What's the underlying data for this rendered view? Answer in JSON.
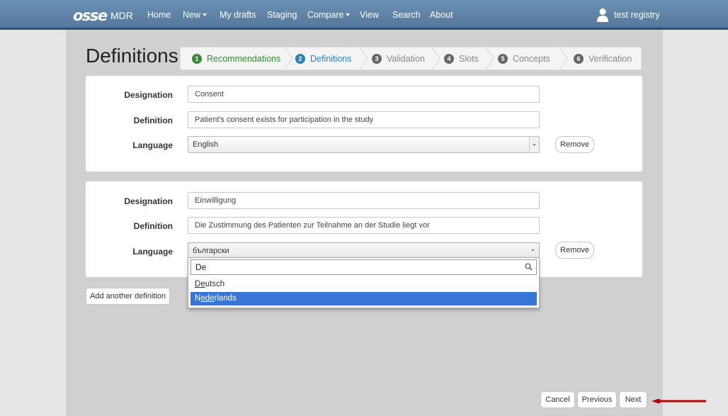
{
  "navbar": {
    "brand": "osse",
    "brand_suffix": "MDR",
    "items": [
      {
        "label": "Home"
      },
      {
        "label": "New",
        "dropdown": true
      },
      {
        "label": "My drafts"
      },
      {
        "label": "Staging"
      },
      {
        "label": "Compare",
        "dropdown": true
      },
      {
        "label": "View"
      },
      {
        "label": "Search"
      },
      {
        "label": "About"
      }
    ],
    "user": "test registry"
  },
  "page": {
    "title": "Definitions"
  },
  "wizard": {
    "steps": [
      {
        "num": "1",
        "label": "Recommendations",
        "state": "done"
      },
      {
        "num": "2",
        "label": "Definitions",
        "state": "active"
      },
      {
        "num": "3",
        "label": "Validation",
        "state": "todo"
      },
      {
        "num": "4",
        "label": "Slots",
        "state": "todo"
      },
      {
        "num": "5",
        "label": "Concepts",
        "state": "todo"
      },
      {
        "num": "6",
        "label": "Verification",
        "state": "todo"
      }
    ]
  },
  "labels": {
    "designation": "Designation",
    "definition": "Definition",
    "language": "Language"
  },
  "definitions": [
    {
      "designation": "Consent",
      "definition": "Patient's consent exists for participation in the study",
      "language": "English",
      "remove_label": "Remove"
    },
    {
      "designation": "Einwilligung",
      "definition": "Die Zustimmung des Patienten zur Teilnahme an der Studie liegt vor",
      "language": "български",
      "remove_label": "Remove"
    }
  ],
  "language_dropdown": {
    "search_value": "De",
    "options": [
      {
        "label": "Deutsch",
        "match_prefix": "D",
        "match": "e",
        "match_rest": "utsch",
        "highlighted": false
      },
      {
        "label": "Nederlands",
        "match_prefix": "N",
        "match": "ede",
        "match_rest": "rlands",
        "highlighted": true
      }
    ]
  },
  "buttons": {
    "add_definition": "Add another definition",
    "cancel": "Cancel",
    "previous": "Previous",
    "next": "Next"
  },
  "colors": {
    "navbar": "#6a90b5",
    "step_done": "#3a8a3a",
    "step_active": "#2f7fb5",
    "step_todo": "#666666",
    "highlight": "#3875d7",
    "arrow": "#c00000"
  }
}
